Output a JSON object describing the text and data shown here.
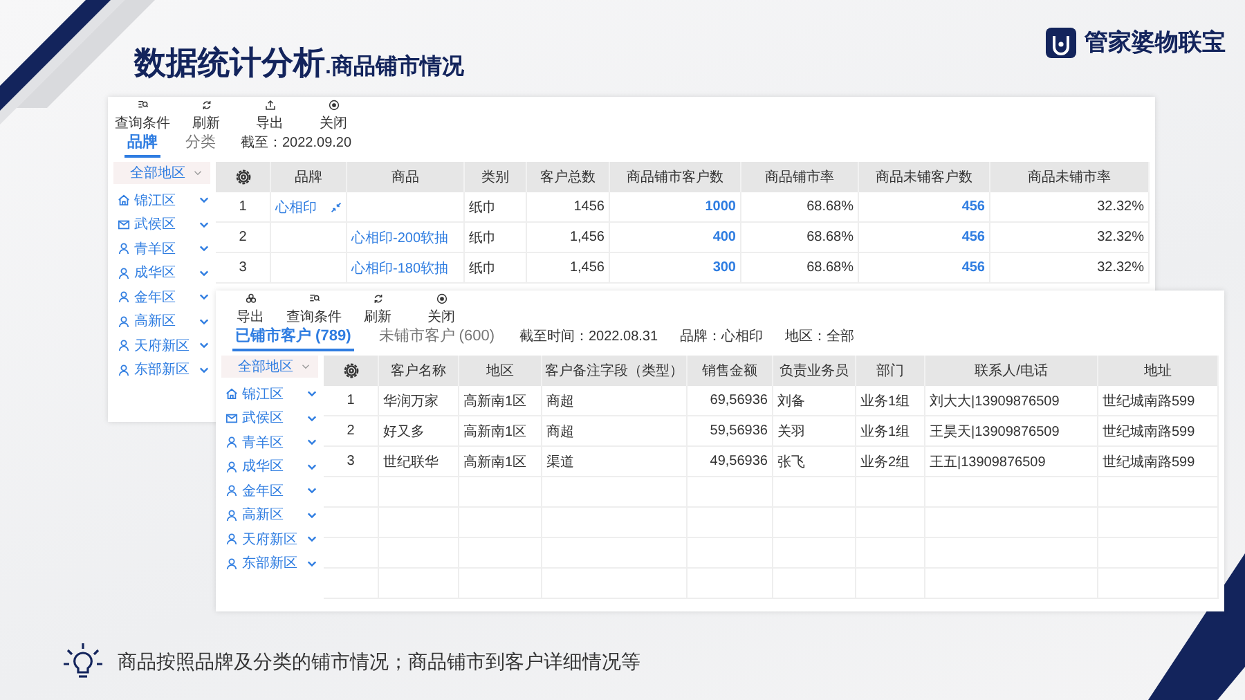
{
  "slide": {
    "title": "数据统计分析",
    "subtitle": ".商品铺市情况",
    "logo": "管家婆物联宝",
    "caption": "商品按照品牌及分类的铺市情况；商品铺市到客户详细情况等"
  },
  "brand_window": {
    "toolbar": [
      {
        "label": "查询条件",
        "kind": "filter"
      },
      {
        "label": "刷新",
        "kind": "refresh"
      },
      {
        "label": "导出",
        "kind": "upload"
      },
      {
        "label": "关闭",
        "kind": "target"
      }
    ],
    "tabs": [
      {
        "label": "品牌",
        "selected": true
      },
      {
        "label": "分类",
        "selected": false
      }
    ],
    "meta": [
      "截至：2022.09.20"
    ],
    "region_select": "全部地区",
    "regions": [
      {
        "label": "锦江区",
        "kind": "home"
      },
      {
        "label": "武侯区",
        "kind": "mail"
      },
      {
        "label": "青羊区",
        "kind": "person"
      },
      {
        "label": "成华区",
        "kind": "person"
      },
      {
        "label": "金年区",
        "kind": "person"
      },
      {
        "label": "高新区",
        "kind": "person"
      },
      {
        "label": "天府新区",
        "kind": "person"
      },
      {
        "label": "东部新区",
        "kind": "person"
      }
    ],
    "table": {
      "columns": [
        {
          "kind": "index"
        },
        {
          "label": "品牌",
          "kind": "link"
        },
        {
          "label": "商品",
          "kind": "link"
        },
        {
          "label": "类别",
          "kind": "text"
        },
        {
          "label": "客户总数",
          "kind": "number"
        },
        {
          "label": "商品铺市客户数",
          "kind": "strong"
        },
        {
          "label": "商品铺市率",
          "kind": "number"
        },
        {
          "label": "商品未铺客户数",
          "kind": "strong"
        },
        {
          "label": "商品未铺市率",
          "kind": "number"
        }
      ],
      "rows": [
        {
          "grouped": true,
          "cells": [
            "1",
            "心相印",
            "",
            "纸巾",
            "1456",
            "1000",
            "68.68%",
            "456",
            "32.32%"
          ]
        },
        {
          "grouped": false,
          "cells": [
            "2",
            "",
            "心相印-200软抽",
            "纸巾",
            "1,456",
            "400",
            "68.68%",
            "456",
            "32.32%"
          ]
        },
        {
          "grouped": false,
          "cells": [
            "3",
            "",
            "心相印-180软抽",
            "纸巾",
            "1,456",
            "300",
            "68.68%",
            "456",
            "32.32%"
          ]
        }
      ]
    }
  },
  "customer_window": {
    "toolbar": [
      {
        "label": "导出",
        "kind": "flower"
      },
      {
        "label": "查询条件",
        "kind": "filter"
      },
      {
        "label": "刷新",
        "kind": "refresh"
      },
      {
        "label": "关闭",
        "kind": "target"
      }
    ],
    "tabs": [
      {
        "label": "已铺市客户 (789)",
        "selected": true
      },
      {
        "label": "未铺市客户 (600)",
        "selected": false
      }
    ],
    "meta": [
      "截至时间：2022.08.31",
      "品牌：心相印",
      "地区：全部"
    ],
    "region_select": "全部地区",
    "regions": [
      {
        "label": "锦江区",
        "kind": "home"
      },
      {
        "label": "武侯区",
        "kind": "mail"
      },
      {
        "label": "青羊区",
        "kind": "person"
      },
      {
        "label": "成华区",
        "kind": "person"
      },
      {
        "label": "金年区",
        "kind": "person"
      },
      {
        "label": "高新区",
        "kind": "person"
      },
      {
        "label": "天府新区",
        "kind": "person"
      },
      {
        "label": "东部新区",
        "kind": "person"
      }
    ],
    "table": {
      "columns": [
        {
          "kind": "index"
        },
        {
          "label": "客户名称",
          "kind": "text"
        },
        {
          "label": "地区",
          "kind": "text"
        },
        {
          "label": "客户备注字段（类型）",
          "kind": "text"
        },
        {
          "label": "销售金额",
          "kind": "number"
        },
        {
          "label": "负责业务员",
          "kind": "text"
        },
        {
          "label": "部门",
          "kind": "text"
        },
        {
          "label": "联系人/电话",
          "kind": "text"
        },
        {
          "label": "地址",
          "kind": "text"
        }
      ],
      "rows": [
        {
          "cells": [
            "1",
            "华润万家",
            "高新南1区",
            "商超",
            "69,56936",
            "刘备",
            "业务1组",
            "刘大大|13909876509",
            "世纪城南路599"
          ]
        },
        {
          "cells": [
            "2",
            "好又多",
            "高新南1区",
            "商超",
            "59,56936",
            "关羽",
            "业务1组",
            "王昊天|13909876509",
            "世纪城南路599"
          ]
        },
        {
          "cells": [
            "3",
            "世纪联华",
            "高新南1区",
            "渠道",
            "49,56936",
            "张飞",
            "业务2组",
            "王五|13909876509",
            "世纪城南路599"
          ]
        }
      ]
    }
  }
}
